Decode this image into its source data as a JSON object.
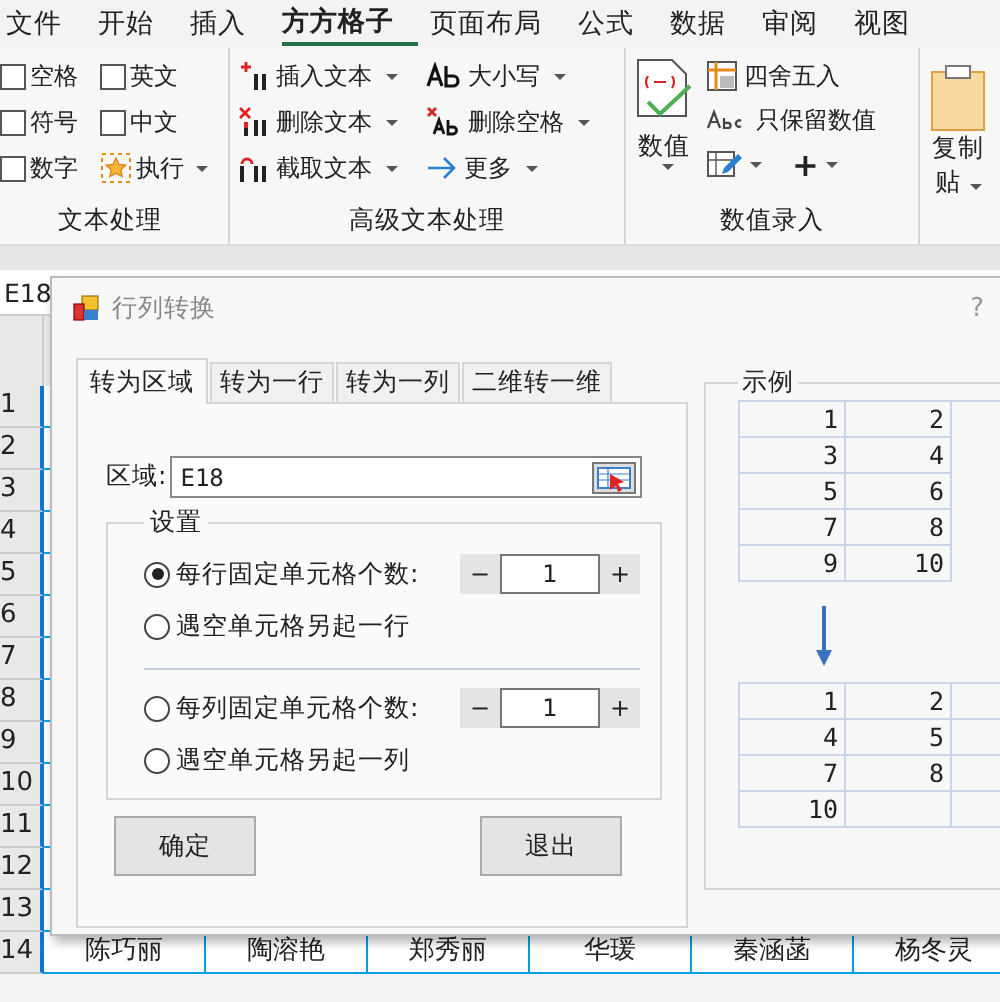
{
  "ribbon_tabs": [
    {
      "label": "文件",
      "selected": false
    },
    {
      "label": "开始",
      "selected": false
    },
    {
      "label": "插入",
      "selected": false
    },
    {
      "label": "方方格子",
      "selected": true
    },
    {
      "label": "页面布局",
      "selected": false
    },
    {
      "label": "公式",
      "selected": false
    },
    {
      "label": "数据",
      "selected": false
    },
    {
      "label": "审阅",
      "selected": false
    },
    {
      "label": "视图",
      "selected": false
    }
  ],
  "text_group": {
    "title": "文本处理",
    "checkboxes": [
      {
        "label": "空格",
        "checked": false
      },
      {
        "label": "英文",
        "checked": false
      },
      {
        "label": "符号",
        "checked": false
      },
      {
        "label": "中文",
        "checked": false
      },
      {
        "label": "数字",
        "checked": false
      }
    ],
    "run_button": "执行"
  },
  "advanced_group": {
    "title": "高级文本处理",
    "buttons": [
      {
        "label": "插入文本",
        "kind": "insert"
      },
      {
        "label": "删除文本",
        "kind": "delete"
      },
      {
        "label": "截取文本",
        "kind": "cut"
      },
      {
        "label": "大小写",
        "kind": "case"
      },
      {
        "label": "删除空格",
        "kind": "space"
      },
      {
        "label": "更多",
        "kind": "more"
      }
    ]
  },
  "number_group": {
    "title": "数值录入",
    "big_button": "数值",
    "buttons": [
      "四舍五入",
      "只保留数值"
    ],
    "plus": "+"
  },
  "paste_button": {
    "line_1": "复制",
    "line_2": "贴"
  },
  "name_box": "E18",
  "row_headers": [
    "1",
    "2",
    "3",
    "4",
    "5",
    "6",
    "7",
    "8",
    "9",
    "10",
    "11",
    "12",
    "13",
    "14"
  ],
  "row_14": [
    "陈巧丽",
    "陶溶艳",
    "郑秀丽",
    "华瑗",
    "秦涵菡",
    "杨冬灵"
  ],
  "dialog": {
    "title": "行列转换",
    "help": "?",
    "tabs": [
      {
        "label": "转为区域",
        "selected": true
      },
      {
        "label": "转为一行",
        "selected": false
      },
      {
        "label": "转为一列",
        "selected": false
      },
      {
        "label": "二维转一维",
        "selected": false
      }
    ],
    "range_label": "区域:",
    "range_value": "E18",
    "settings_title": "设置",
    "options": [
      {
        "kind": "spinner",
        "label": "每行固定单元格个数:",
        "selected": true,
        "value": "1",
        "minus": "−",
        "plus": "+"
      },
      {
        "kind": "plain",
        "label": "遇空单元格另起一行",
        "selected": false
      },
      {
        "kind": "divider"
      },
      {
        "kind": "spinner",
        "label": "每列固定单元格个数:",
        "selected": false,
        "value": "1",
        "minus": "−",
        "plus": "+"
      },
      {
        "kind": "plain",
        "label": "遇空单元格另起一列",
        "selected": false
      }
    ],
    "ok_button": "确定",
    "exit_button": "退出",
    "example_title": "示例",
    "example_before": [
      [
        "1",
        "2"
      ],
      [
        "3",
        "4"
      ],
      [
        "5",
        "6"
      ],
      [
        "7",
        "8"
      ],
      [
        "9",
        "10"
      ]
    ],
    "example_after": [
      [
        "1",
        "2"
      ],
      [
        "4",
        "5"
      ],
      [
        "7",
        "8"
      ],
      [
        "10"
      ]
    ]
  }
}
